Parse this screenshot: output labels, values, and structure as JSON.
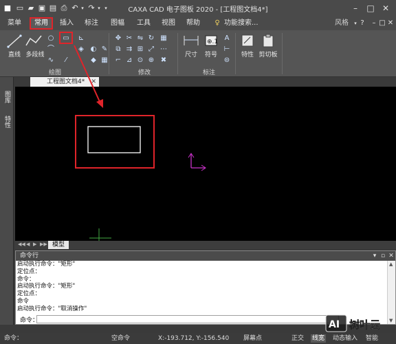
{
  "titlebar": {
    "title": "CAXA CAD 电子图板 2020 - [工程图文档4*]",
    "quick_access_icons": [
      "app-logo-icon",
      "new-file-icon",
      "open-file-icon",
      "save-icon",
      "save-all-icon",
      "print-icon",
      "undo-icon",
      "redo-icon",
      "customize-icon"
    ],
    "window_buttons": [
      "minimize-icon",
      "maximize-icon",
      "close-icon"
    ]
  },
  "menubar": {
    "items": [
      "菜单",
      "常用",
      "插入",
      "标注",
      "图幅",
      "工具",
      "视图",
      "帮助"
    ],
    "search_label": "功能搜索...",
    "style_label": "风格",
    "active_item": "常用"
  },
  "ribbon": {
    "draw_tools": {
      "line": "直线",
      "polyline": "多段线"
    },
    "groups": [
      "绘图",
      "修改",
      "标注"
    ],
    "annotation_tools": {
      "dimension": "尺寸",
      "symbol": "符号"
    },
    "property_tools": {
      "properties": "特性",
      "clipboard": "剪切板"
    }
  },
  "leftpanel": {
    "tabs": [
      "图库",
      "特性"
    ]
  },
  "document": {
    "tab_label": "工程图文档4*"
  },
  "model_tab": "模型",
  "command_window": {
    "header": "命令行",
    "lines": [
      "启动执行命令：\"矩形\"",
      "定位点：",
      "命令：",
      "启动执行命令：\"矩形\"",
      "定位点：",
      "命令",
      "启动执行命令：\"取消操作\""
    ],
    "prompt": "命令："
  },
  "statusbar": {
    "left": "命令：",
    "mode": "空命令",
    "coords": "X:-193.712, Y:-156.540",
    "snap": "屏幕点",
    "ortho": "正交",
    "linewidth": "线宽",
    "dynamic_input": "动态输入",
    "smart": "智能"
  },
  "watermark": {
    "text": "树叶云"
  },
  "colors": {
    "highlight_red": "#e0242a",
    "canvas_bg": "#000000",
    "ucs_magenta": "#cc33cc",
    "rect_white": "#ffffff"
  }
}
